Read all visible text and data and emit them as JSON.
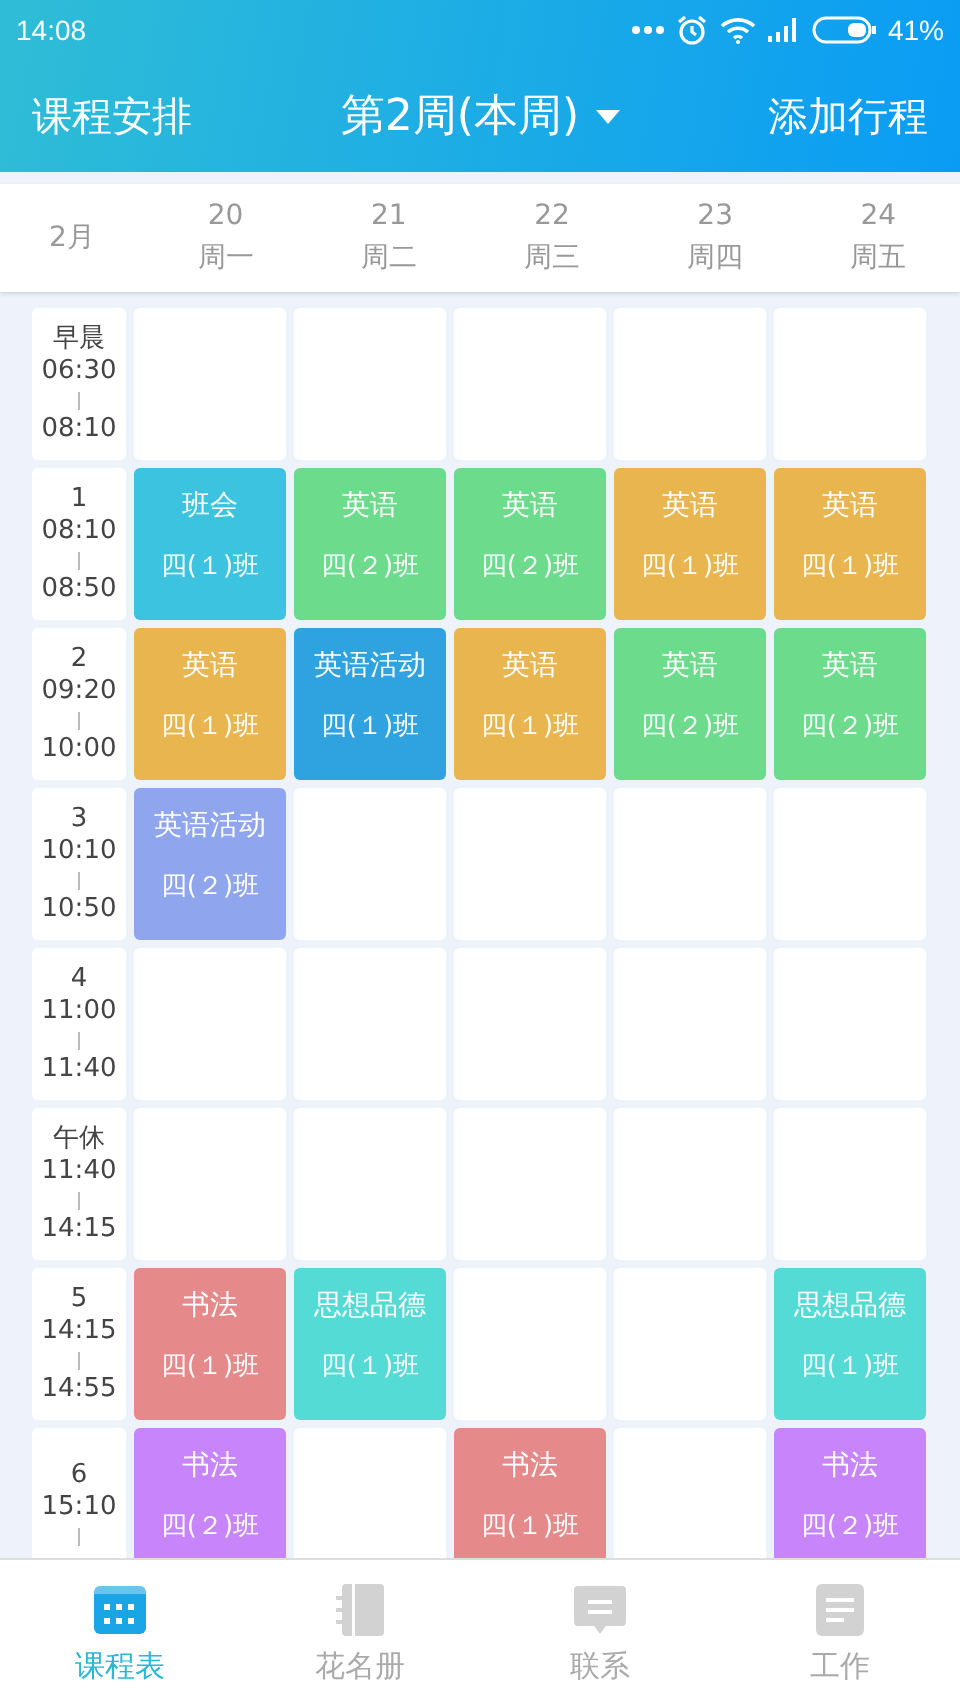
{
  "status_bar": {
    "time": "14:08",
    "battery": "41%"
  },
  "header": {
    "title": "课程安排",
    "week": "第2周(本周)",
    "action": "添加行程"
  },
  "date_header": {
    "month": "2月",
    "days": [
      {
        "date": "20",
        "weekday": "周一"
      },
      {
        "date": "21",
        "weekday": "周二"
      },
      {
        "date": "22",
        "weekday": "周三"
      },
      {
        "date": "23",
        "weekday": "周四"
      },
      {
        "date": "24",
        "weekday": "周五"
      }
    ]
  },
  "slots": [
    {
      "label": "早晨",
      "start": "06:30",
      "end": "08:10",
      "cells": [
        {
          "kind": "empty"
        },
        {
          "kind": "empty"
        },
        {
          "kind": "empty"
        },
        {
          "kind": "empty"
        },
        {
          "kind": "empty"
        }
      ]
    },
    {
      "label": "1",
      "start": "08:10",
      "end": "08:50",
      "cells": [
        {
          "kind": "course",
          "subject": "班会",
          "class": "四(１)班",
          "color": "#3cc3e0"
        },
        {
          "kind": "course",
          "subject": "英语",
          "class": "四(２)班",
          "color": "#6cdc8c"
        },
        {
          "kind": "course",
          "subject": "英语",
          "class": "四(２)班",
          "color": "#6cdc8c"
        },
        {
          "kind": "course",
          "subject": "英语",
          "class": "四(１)班",
          "color": "#e8b54e"
        },
        {
          "kind": "course",
          "subject": "英语",
          "class": "四(１)班",
          "color": "#e8b54e"
        }
      ]
    },
    {
      "label": "2",
      "start": "09:20",
      "end": "10:00",
      "cells": [
        {
          "kind": "course",
          "subject": "英语",
          "class": "四(１)班",
          "color": "#e8b54e"
        },
        {
          "kind": "course",
          "subject": "英语活动",
          "class": "四(１)班",
          "color": "#2fa3e0"
        },
        {
          "kind": "course",
          "subject": "英语",
          "class": "四(１)班",
          "color": "#e8b54e"
        },
        {
          "kind": "course",
          "subject": "英语",
          "class": "四(２)班",
          "color": "#6cdc8c"
        },
        {
          "kind": "course",
          "subject": "英语",
          "class": "四(２)班",
          "color": "#6cdc8c"
        }
      ]
    },
    {
      "label": "3",
      "start": "10:10",
      "end": "10:50",
      "cells": [
        {
          "kind": "course",
          "subject": "英语活动",
          "class": "四(２)班",
          "color": "#8fa5ee"
        },
        {
          "kind": "empty"
        },
        {
          "kind": "empty"
        },
        {
          "kind": "empty"
        },
        {
          "kind": "empty"
        }
      ]
    },
    {
      "label": "4",
      "start": "11:00",
      "end": "11:40",
      "cells": [
        {
          "kind": "empty"
        },
        {
          "kind": "empty"
        },
        {
          "kind": "empty"
        },
        {
          "kind": "empty"
        },
        {
          "kind": "empty"
        }
      ]
    },
    {
      "label": "午休",
      "start": "11:40",
      "end": "14:15",
      "cells": [
        {
          "kind": "empty"
        },
        {
          "kind": "empty"
        },
        {
          "kind": "empty"
        },
        {
          "kind": "empty"
        },
        {
          "kind": "empty"
        }
      ]
    },
    {
      "label": "5",
      "start": "14:15",
      "end": "14:55",
      "cells": [
        {
          "kind": "course",
          "subject": "书法",
          "class": "四(１)班",
          "color": "#e5898b"
        },
        {
          "kind": "course",
          "subject": "思想品德",
          "class": "四(１)班",
          "color": "#55dbd6"
        },
        {
          "kind": "empty"
        },
        {
          "kind": "empty"
        },
        {
          "kind": "course",
          "subject": "思想品德",
          "class": "四(１)班",
          "color": "#55dbd6"
        }
      ]
    },
    {
      "label": "6",
      "start": "15:10",
      "cells": [
        {
          "kind": "course",
          "subject": "书法",
          "class": "四(２)班",
          "color": "#c885fb"
        },
        {
          "kind": "empty"
        },
        {
          "kind": "course",
          "subject": "书法",
          "class": "四(１)班",
          "color": "#e5898b"
        },
        {
          "kind": "empty"
        },
        {
          "kind": "course",
          "subject": "书法",
          "class": "四(２)班",
          "color": "#c885fb"
        }
      ]
    }
  ],
  "nav": [
    {
      "label": "课程表",
      "selected": true
    },
    {
      "label": "花名册",
      "selected": false
    },
    {
      "label": "联系",
      "selected": false
    },
    {
      "label": "工作",
      "selected": false
    }
  ]
}
